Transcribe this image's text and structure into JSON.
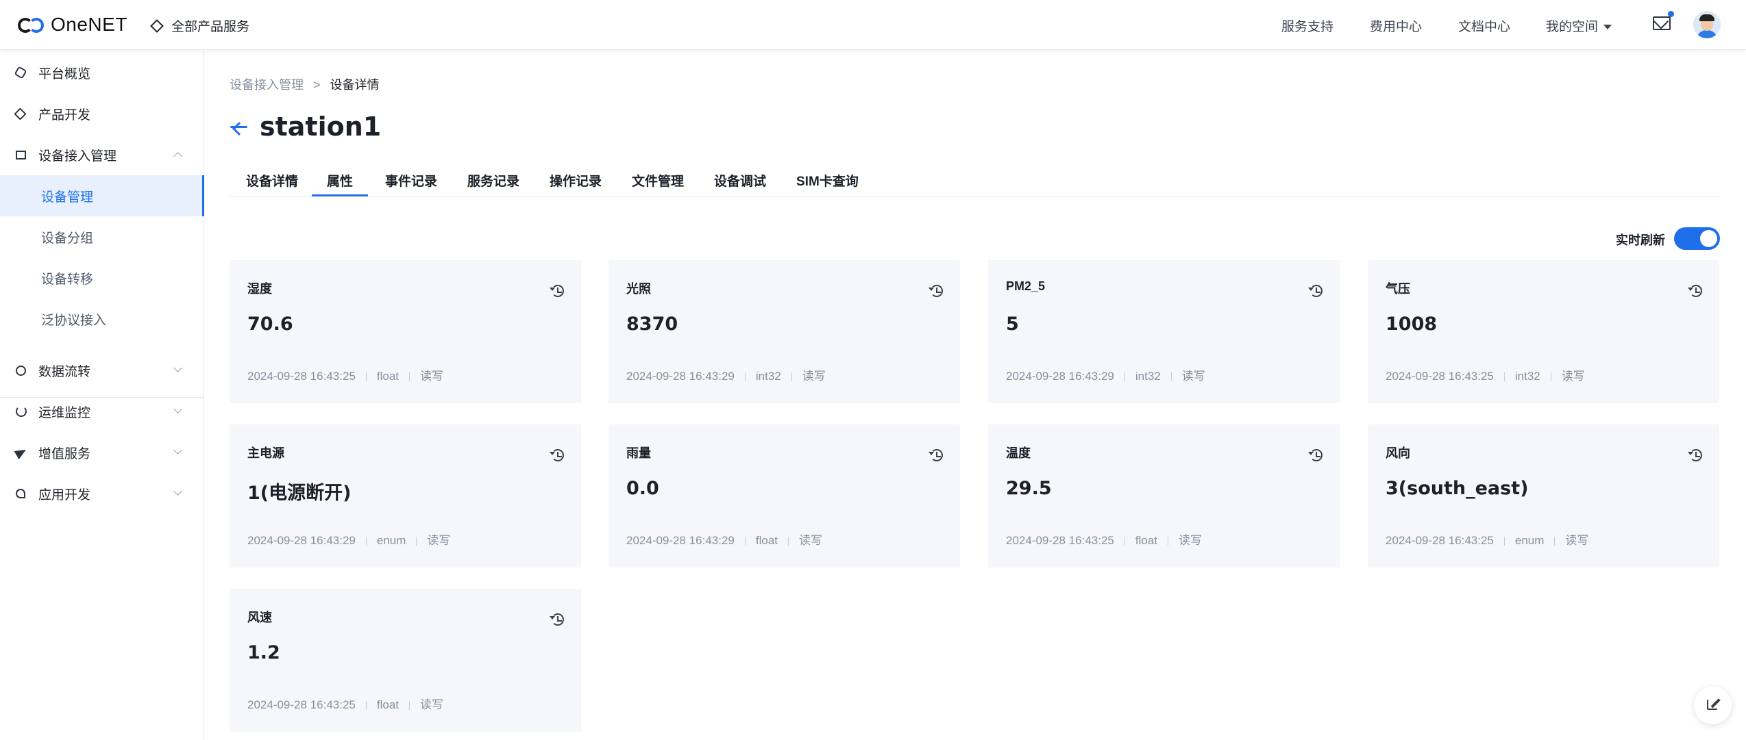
{
  "brand": {
    "logo_text": "OneNET"
  },
  "header": {
    "all_products": "全部产品服务",
    "nav": [
      "服务支持",
      "费用中心",
      "文档中心"
    ],
    "my_space": "我的空间"
  },
  "sidebar": {
    "items": [
      {
        "label": "平台概览",
        "icon": "platform-overview-icon"
      },
      {
        "label": "产品开发",
        "icon": "cube-icon"
      },
      {
        "label": "设备接入管理",
        "icon": "device-access-icon",
        "expanded": true
      },
      {
        "label": "数据流转",
        "icon": "data-flow-icon"
      },
      {
        "label": "运维监控",
        "icon": "monitor-icon"
      },
      {
        "label": "增值服务",
        "icon": "send-icon"
      },
      {
        "label": "应用开发",
        "icon": "app-dev-icon"
      }
    ],
    "subitems": [
      "设备管理",
      "设备分组",
      "设备转移",
      "泛协议接入"
    ]
  },
  "breadcrumb": {
    "parent": "设备接入管理",
    "separator": ">",
    "current": "设备详情"
  },
  "page_title": "station1",
  "tabs": [
    "设备详情",
    "属性",
    "事件记录",
    "服务记录",
    "操作记录",
    "文件管理",
    "设备调试",
    "SIM卡查询"
  ],
  "active_tab": "属性",
  "realtime_refresh": {
    "label": "实时刷新",
    "enabled": true
  },
  "properties": [
    {
      "name": "湿度",
      "value": "70.6",
      "time": "2024-09-28 16:43:25",
      "type": "float",
      "access": "读写"
    },
    {
      "name": "光照",
      "value": "8370",
      "time": "2024-09-28 16:43:29",
      "type": "int32",
      "access": "读写"
    },
    {
      "name": "PM2_5",
      "value": "5",
      "time": "2024-09-28 16:43:29",
      "type": "int32",
      "access": "读写"
    },
    {
      "name": "气压",
      "value": "1008",
      "time": "2024-09-28 16:43:25",
      "type": "int32",
      "access": "读写"
    },
    {
      "name": "主电源",
      "value": "1(电源断开)",
      "time": "2024-09-28 16:43:29",
      "type": "enum",
      "access": "读写"
    },
    {
      "name": "雨量",
      "value": "0.0",
      "time": "2024-09-28 16:43:29",
      "type": "float",
      "access": "读写"
    },
    {
      "name": "温度",
      "value": "29.5",
      "time": "2024-09-28 16:43:25",
      "type": "float",
      "access": "读写"
    },
    {
      "name": "风向",
      "value": "3(south_east)",
      "time": "2024-09-28 16:43:25",
      "type": "enum",
      "access": "读写"
    },
    {
      "name": "风速",
      "value": "1.2",
      "time": "2024-09-28 16:43:25",
      "type": "float",
      "access": "读写"
    }
  ],
  "colors": {
    "accent": "#1f6feb",
    "card_bg": "#f5f7fa",
    "active_nav_bg": "#e8f0fd"
  }
}
